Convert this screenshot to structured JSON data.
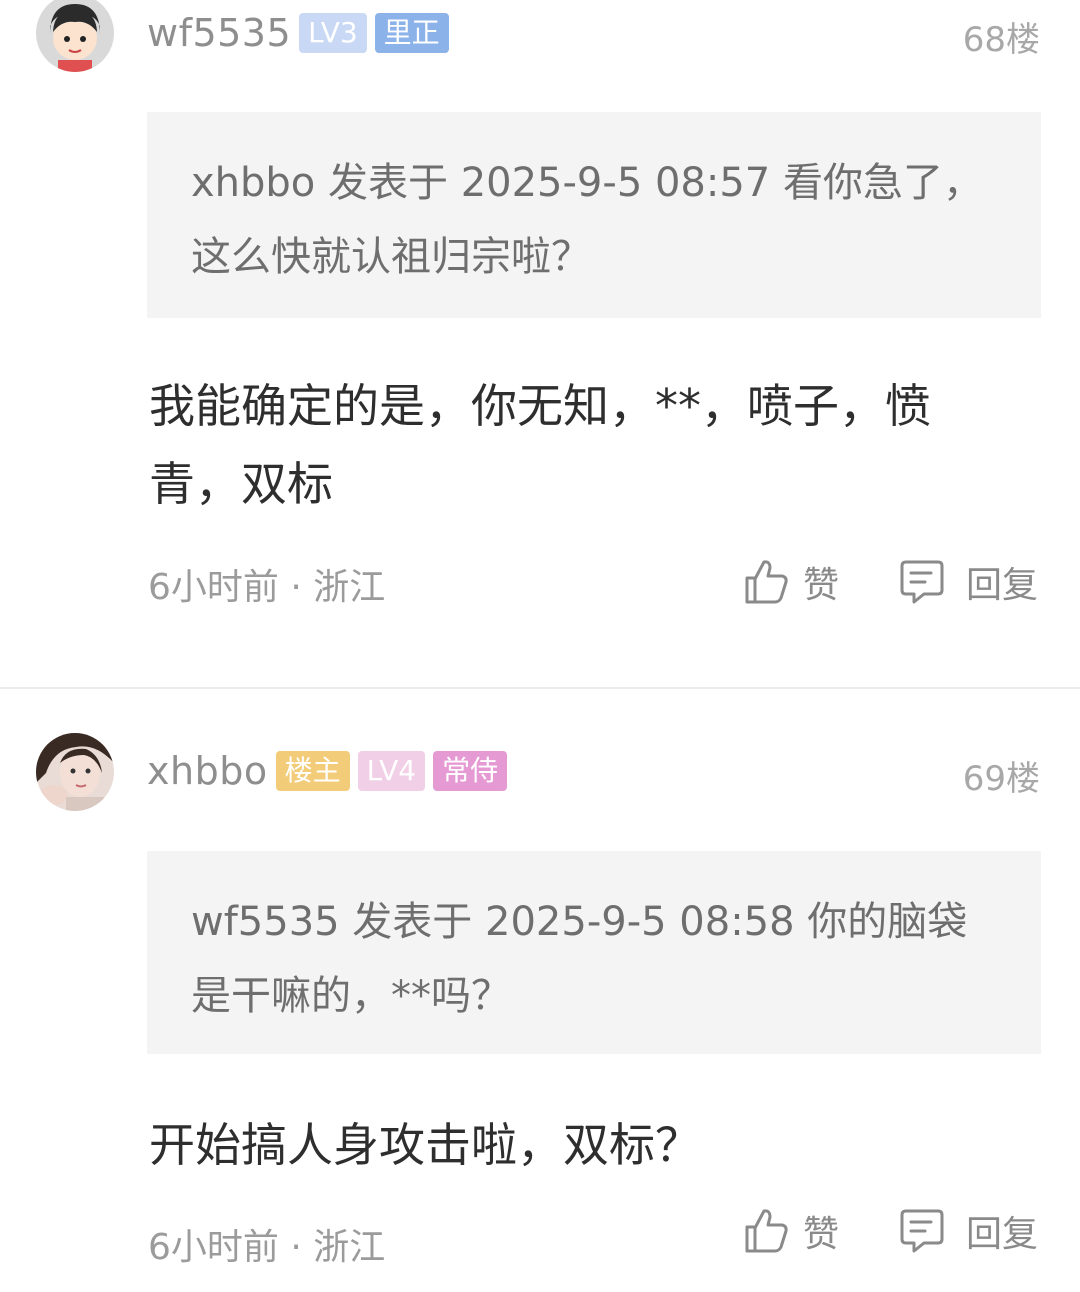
{
  "posts": [
    {
      "username": "wf5535",
      "badges": [
        "LV3",
        "里正"
      ],
      "floor": "68楼",
      "quote": "xhbbo 发表于 2025-9-5 08:57 看你急了，这么快就认祖归宗啦？",
      "body": "我能确定的是，你无知，**，喷子，愤青，双标",
      "meta": "6小时前 · 浙江",
      "like_label": "赞",
      "reply_label": "回复"
    },
    {
      "username": "xhbbo",
      "badges": [
        "楼主",
        "LV4",
        "常侍"
      ],
      "floor": "69楼",
      "quote": "wf5535 发表于 2025-9-5 08:58 你的脑袋是干嘛的，**吗？",
      "body": "开始搞人身攻击啦，双标？",
      "meta": "6小时前 · 浙江",
      "like_label": "赞",
      "reply_label": "回复"
    }
  ],
  "icons": {
    "like": "thumbs-up-icon",
    "reply": "comment-bubble-icon"
  },
  "colors": {
    "badge_lv3": "#c9d9f5",
    "badge_title_blue": "#8cb2ea",
    "badge_owner": "#f3cc79",
    "badge_lv4": "#f1cfe7",
    "badge_title_pink": "#e59ad4",
    "quote_bg": "#f4f4f4"
  }
}
